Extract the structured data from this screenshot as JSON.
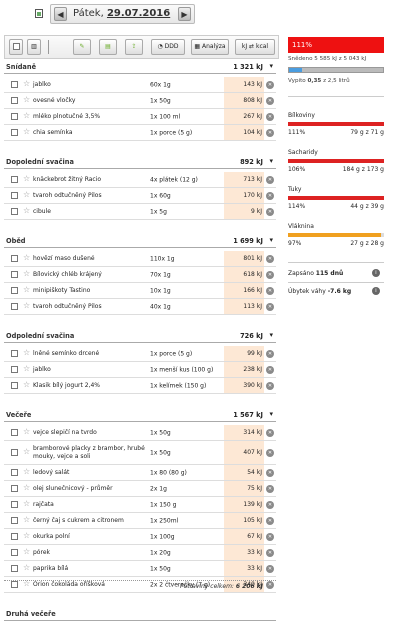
{
  "date_bar": {
    "day_label": "Pátek,",
    "date": "29.07.2016",
    "prev": "◀",
    "next": "▶"
  },
  "toolbar": {
    "ddd_label": "DDD",
    "analyza_label": "Analýza",
    "kj_label": "kJ",
    "kcal_label": "kcal"
  },
  "summary": {
    "percent": "111%",
    "eaten_text": "Snědeno 5 585 kJ z 5 043 kJ",
    "drink_prefix": "Vypito",
    "drink_value": "0,35",
    "drink_suffix": "z 2,5 litrů",
    "nutrients": [
      {
        "name": "Bílkoviny",
        "percent": "111%",
        "value": "79 g z 71 g",
        "fill": 1.0,
        "color": "#d22"
      },
      {
        "name": "Sacharidy",
        "percent": "106%",
        "value": "184 g z 173 g",
        "fill": 1.0,
        "color": "#d22"
      },
      {
        "name": "Tuky",
        "percent": "114%",
        "value": "44 g z 39 g",
        "fill": 1.0,
        "color": "#d22"
      },
      {
        "name": "Vláknina",
        "percent": "97%",
        "value": "27 g z 28 g",
        "fill": 0.97,
        "color": "#f0a020"
      }
    ],
    "zapsano_label": "Zapsáno",
    "zapsano_value": "115 dnů",
    "ubytek_label": "Úbytek váhy",
    "ubytek_value": "-7.6 kg"
  },
  "meals": [
    {
      "name": "Snídaně",
      "kj": "1 321 kJ",
      "items": [
        {
          "name": "jablko",
          "amount": "60x 1g",
          "kj": "143 kJ"
        },
        {
          "name": "ovesné vločky",
          "amount": "1x 50g",
          "kj": "808 kJ"
        },
        {
          "name": "mléko plnotučné 3,5%",
          "amount": "1x 100 ml",
          "kj": "267 kJ"
        },
        {
          "name": "chia semínka",
          "amount": "1x porce (5 g)",
          "kj": "104 kJ"
        }
      ]
    },
    {
      "name": "Dopolední svačina",
      "kj": "892 kJ",
      "items": [
        {
          "name": "knäckebrot žitný Racio",
          "amount": "4x plátek (12 g)",
          "kj": "713 kJ"
        },
        {
          "name": "tvaroh odtučněný Pilos",
          "amount": "1x 60g",
          "kj": "170 kJ"
        },
        {
          "name": "cibule",
          "amount": "1x 5g",
          "kj": "9 kJ"
        }
      ]
    },
    {
      "name": "Oběd",
      "kj": "1 699 kJ",
      "items": [
        {
          "name": "hovězí maso dušené",
          "amount": "110x 1g",
          "kj": "801 kJ"
        },
        {
          "name": "Bílovický chléb krájený",
          "amount": "70x 1g",
          "kj": "618 kJ"
        },
        {
          "name": "minipiškoty Tastino",
          "amount": "10x 1g",
          "kj": "166 kJ"
        },
        {
          "name": "tvaroh odtučněný Pilos",
          "amount": "40x 1g",
          "kj": "113 kJ"
        }
      ]
    },
    {
      "name": "Odpolední svačina",
      "kj": "726 kJ",
      "items": [
        {
          "name": "lněné semínko drcené",
          "amount": "1x porce (5 g)",
          "kj": "99 kJ"
        },
        {
          "name": "jablko",
          "amount": "1x menší kus (100 g)",
          "kj": "238 kJ"
        },
        {
          "name": "Klasik bílý jogurt 2,4%",
          "amount": "1x kelímek (150 g)",
          "kj": "390 kJ"
        }
      ]
    },
    {
      "name": "Večeře",
      "kj": "1 567 kJ",
      "items": [
        {
          "name": "vejce slepičí na tvrdo",
          "amount": "1x 50g",
          "kj": "314 kJ"
        },
        {
          "name": "bramborové placky z brambor, hrubé mouky, vejce a soli",
          "amount": "1x 50g",
          "kj": "407 kJ"
        },
        {
          "name": "ledový salát",
          "amount": "1x 80 (80 g)",
          "kj": "54 kJ"
        },
        {
          "name": "olej slunečnicový - průměr",
          "amount": "2x 1g",
          "kj": "75 kJ"
        },
        {
          "name": "rajčata",
          "amount": "1x 150 g",
          "kj": "139 kJ"
        },
        {
          "name": "černý čaj s cukrem a citronem",
          "amount": "1x 250ml",
          "kj": "105 kJ"
        },
        {
          "name": "okurka polní",
          "amount": "1x 100g",
          "kj": "67 kJ"
        },
        {
          "name": "pórek",
          "amount": "1x 20g",
          "kj": "33 kJ"
        },
        {
          "name": "paprika bílá",
          "amount": "1x 50g",
          "kj": "33 kJ"
        },
        {
          "name": "Orion čokoláda oříšková",
          "amount": "2x 2 čtverečky (7 g)",
          "kj": "340 kJ"
        }
      ]
    },
    {
      "name": "Druhá večeře",
      "kj": "",
      "items": []
    }
  ],
  "footer": {
    "total_label": "Potraviny celkem:",
    "total_value": "6 206 kJ"
  }
}
